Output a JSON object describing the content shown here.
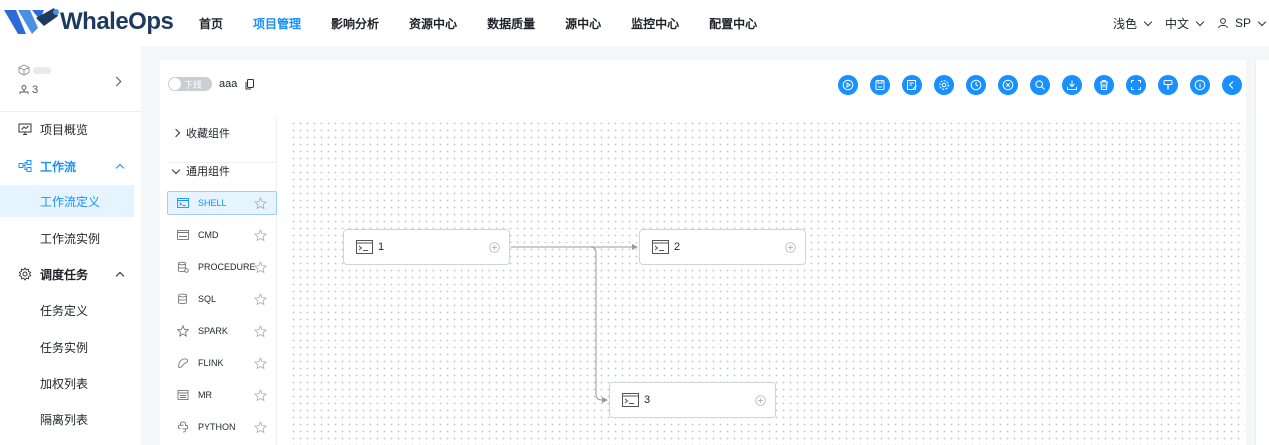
{
  "brand": {
    "name": "WhaleOps",
    "accent": "#1890ff"
  },
  "nav": {
    "items": [
      {
        "label": "首页",
        "active": false
      },
      {
        "label": "项目管理",
        "active": true
      },
      {
        "label": "影响分析",
        "active": false
      },
      {
        "label": "资源中心",
        "active": false
      },
      {
        "label": "数据质量",
        "active": false
      },
      {
        "label": "源中心",
        "active": false
      },
      {
        "label": "监控中心",
        "active": false
      },
      {
        "label": "配置中心",
        "active": false
      }
    ],
    "theme_label": "浅色",
    "lang_label": "中文",
    "user_label": "SP"
  },
  "sidebar": {
    "project_user_count": "3",
    "items": [
      {
        "label": "项目概览",
        "icon": "monitor-icon"
      },
      {
        "label": "工作流",
        "icon": "workflow-icon"
      },
      {
        "label": "工作流定义"
      },
      {
        "label": "工作流实例"
      },
      {
        "label": "调度任务",
        "icon": "gear-icon"
      },
      {
        "label": "任务定义"
      },
      {
        "label": "任务实例"
      },
      {
        "label": "加权列表"
      },
      {
        "label": "隔离列表"
      }
    ]
  },
  "editor": {
    "switch_label": "下线",
    "workflow_name": "aaa",
    "toolbar_icons": [
      "play-icon",
      "save-icon",
      "edit-icon",
      "gear-icon",
      "clock-icon",
      "close-circle-icon",
      "search-icon",
      "download-icon",
      "trash-icon",
      "fullscreen-icon",
      "format-icon",
      "info-icon",
      "back-icon"
    ]
  },
  "components": {
    "favorites_label": "收藏组件",
    "common_label": "通用组件",
    "items": [
      {
        "label": "SHELL",
        "icon": "terminal-icon"
      },
      {
        "label": "CMD",
        "icon": "cmd-icon"
      },
      {
        "label": "PROCEDURE",
        "icon": "procedure-icon"
      },
      {
        "label": "SQL",
        "icon": "database-icon"
      },
      {
        "label": "SPARK",
        "icon": "spark-icon"
      },
      {
        "label": "FLINK",
        "icon": "flink-icon"
      },
      {
        "label": "MR",
        "icon": "mr-icon"
      },
      {
        "label": "PYTHON",
        "icon": "python-icon"
      }
    ]
  },
  "dag": {
    "nodes": [
      {
        "label": "1"
      },
      {
        "label": "2"
      },
      {
        "label": "3"
      }
    ]
  }
}
